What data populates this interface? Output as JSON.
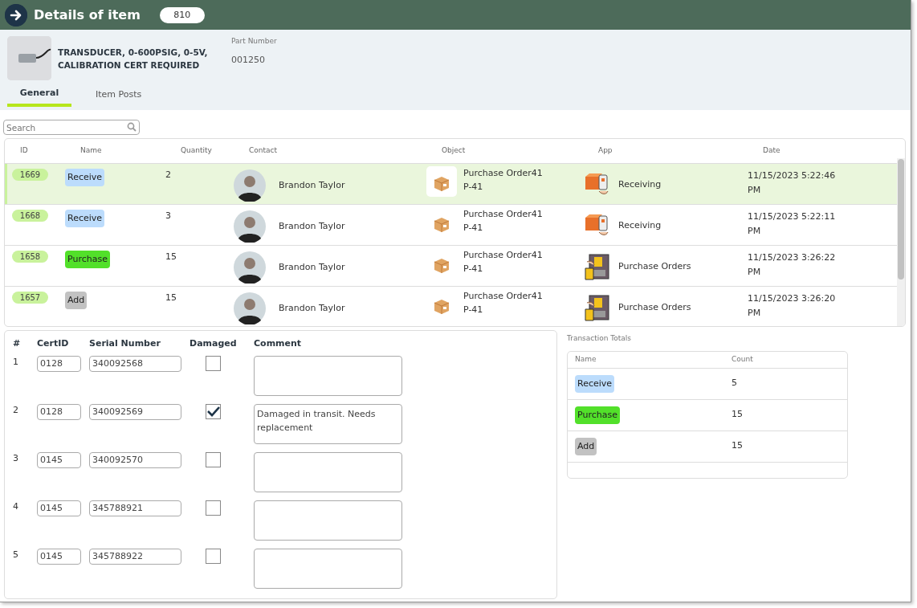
{
  "header": {
    "title": "Details of item",
    "count": "810"
  },
  "item": {
    "name": "TRANSDUCER, 0-600PSIG, 0-5V, CALIBRATION CERT REQUIRED",
    "part_number_label": "Part Number",
    "part_number": "001250"
  },
  "tabs": [
    {
      "label": "General",
      "selected": true
    },
    {
      "label": "Item Posts",
      "selected": false
    }
  ],
  "search": {
    "placeholder": "Search"
  },
  "transactions": {
    "columns": [
      "ID",
      "Name",
      "Quantity",
      "Contact",
      "Object",
      "App",
      "Date"
    ],
    "rows": [
      {
        "id": "1669",
        "name": {
          "label": "Receive",
          "color": "#bcdcfc"
        },
        "quantity": "2",
        "contact": "Brandon Taylor",
        "object": [
          "Purchase Order41",
          "P-41"
        ],
        "app": {
          "label": "Receiving",
          "kind": "receiving"
        },
        "date": "11/15/2023 5:22:46 PM",
        "selected": true
      },
      {
        "id": "1668",
        "name": {
          "label": "Receive",
          "color": "#bcdcfc"
        },
        "quantity": "3",
        "contact": "Brandon Taylor",
        "object": [
          "Purchase Order41",
          "P-41"
        ],
        "app": {
          "label": "Receiving",
          "kind": "receiving"
        },
        "date": "11/15/2023 5:22:11 PM",
        "selected": false
      },
      {
        "id": "1658",
        "name": {
          "label": "Purchase",
          "color": "#52e02a"
        },
        "quantity": "15",
        "contact": "Brandon Taylor",
        "object": [
          "Purchase Order41",
          "P-41"
        ],
        "app": {
          "label": "Purchase Orders",
          "kind": "purchase"
        },
        "date": "11/15/2023 3:26:22 PM",
        "selected": false
      },
      {
        "id": "1657",
        "name": {
          "label": "Add",
          "color": "#c2c2c2"
        },
        "quantity": "15",
        "contact": "Brandon Taylor",
        "object": [
          "Purchase Order41",
          "P-41"
        ],
        "app": {
          "label": "Purchase Orders",
          "kind": "purchase"
        },
        "date": "11/15/2023 3:26:20 PM",
        "selected": false
      }
    ]
  },
  "certs": {
    "columns": [
      "#",
      "CertID",
      "Serial Number",
      "Damaged",
      "Comment"
    ],
    "rows": [
      {
        "number": "1",
        "cert_id": "0128",
        "serial": "340092568",
        "damaged": false
      },
      {
        "number": "2",
        "cert_id": "0128",
        "serial": "340092569",
        "damaged": true,
        "comment": "Damaged in transit. Needs replacement"
      },
      {
        "number": "3",
        "cert_id": "0145",
        "serial": "340092570",
        "damaged": false
      },
      {
        "number": "4",
        "cert_id": "0145",
        "serial": "345788921",
        "damaged": false
      },
      {
        "number": "5",
        "cert_id": "0145",
        "serial": "345788922",
        "damaged": false
      }
    ]
  },
  "totals": {
    "title": "Transaction Totals",
    "columns": [
      "Name",
      "Count"
    ],
    "rows": [
      {
        "name": {
          "label": "Receive",
          "color": "#bcdcfc"
        },
        "count": "5"
      },
      {
        "name": {
          "label": "Purchase",
          "color": "#52e02a"
        },
        "count": "15"
      },
      {
        "name": {
          "label": "Add",
          "color": "#c2c2c2"
        },
        "count": "15"
      }
    ]
  }
}
